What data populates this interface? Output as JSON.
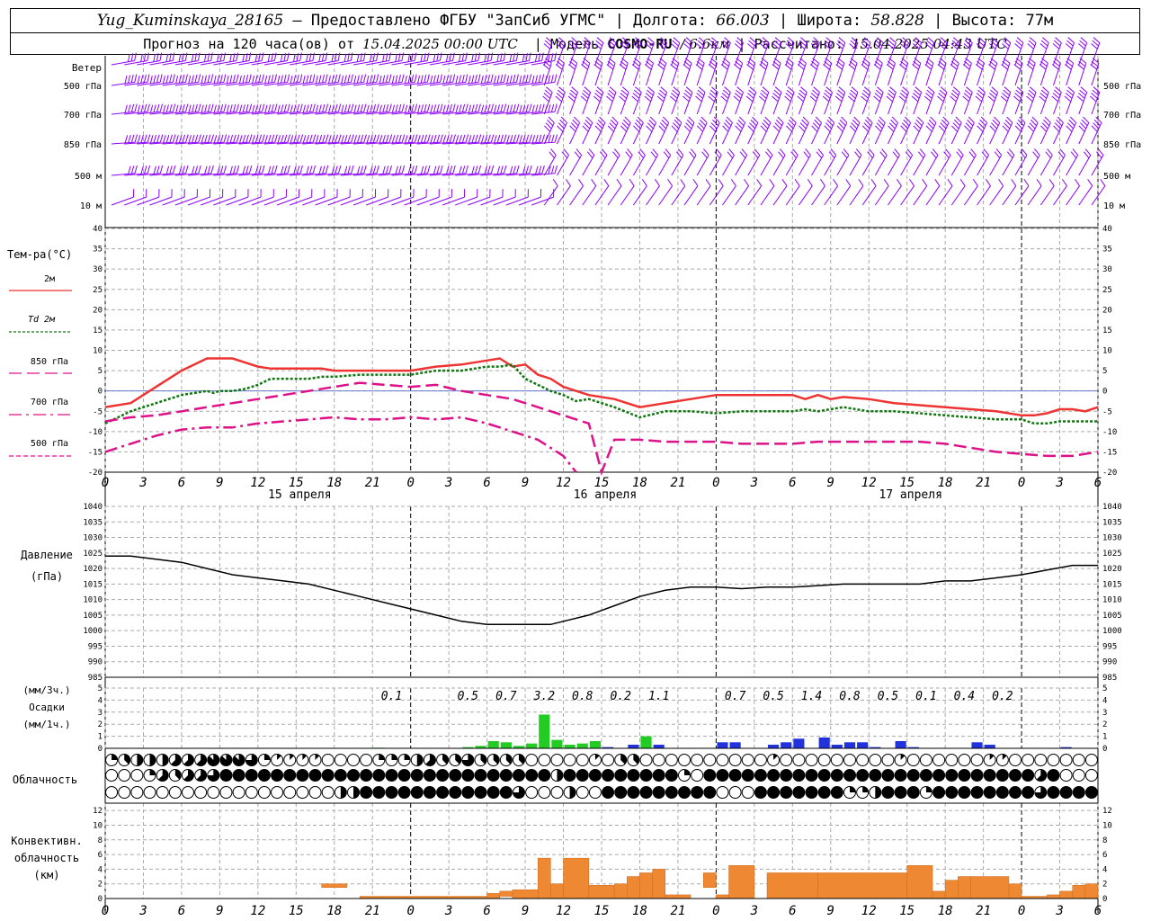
{
  "header": {
    "station": "Yug_Kuminskaya_28165",
    "provided": "— Предоставлено ФГБУ \"ЗапСиб УГМС\"",
    "lon_label": "Долгота:",
    "lon": "66.003",
    "lat_label": "Широта:",
    "lat": "58.828",
    "alt_label": "Высота:",
    "alt": "77м",
    "forecast_prefix": "Прогноз на 120 часа(ов) от",
    "forecast_time": "15.04.2025 00:00 UTC",
    "model_label": "Модель",
    "model": "COSMO-RU",
    "resolution": "/ 6.6км",
    "calc_label": "Рассчитано:",
    "calc_time": "15.04.2025 04:43 UTC"
  },
  "x_ticks": [
    "0",
    "3",
    "6",
    "9",
    "12",
    "15",
    "18",
    "21",
    "0",
    "3",
    "6",
    "9",
    "12",
    "15",
    "18",
    "21",
    "0",
    "3",
    "6",
    "9",
    "12",
    "15",
    "18",
    "21",
    "0",
    "3",
    "6"
  ],
  "day_labels": [
    {
      "text": "15 апреля",
      "hour": 15
    },
    {
      "text": "16 апреля",
      "hour": 39
    },
    {
      "text": "17 апреля",
      "hour": 63
    }
  ],
  "wind_panel": {
    "title": "Ветер",
    "levels": [
      "500 гПа",
      "700 гПа",
      "850 гПа",
      "500 м",
      "10 м"
    ],
    "color": "#8b00ff"
  },
  "chart_data": [
    {
      "type": "line",
      "title": "Тем-ра(°C)",
      "ylim": [
        -20,
        40
      ],
      "y_ticks": [
        -20,
        -15,
        -10,
        -5,
        0,
        5,
        10,
        15,
        20,
        25,
        30,
        35,
        40
      ],
      "series": [
        {
          "name": "2м",
          "color": "#ee3333",
          "style": "solid",
          "hours": [
            0,
            2,
            4,
            6,
            8,
            10,
            11,
            12,
            13,
            14,
            15,
            16,
            17,
            18,
            19,
            20,
            22,
            24,
            26,
            28,
            30,
            31,
            32,
            33,
            34,
            35,
            36,
            37,
            38,
            40,
            42,
            44,
            46,
            48,
            50,
            52,
            54,
            55,
            56,
            57,
            58,
            60,
            62,
            64,
            66,
            68,
            70,
            72,
            73,
            74,
            75,
            76,
            77,
            78
          ],
          "values": [
            -4,
            -3,
            1,
            5,
            8,
            8,
            7,
            6,
            5.5,
            5.5,
            5.5,
            5.5,
            5.5,
            5,
            5,
            5,
            5,
            5,
            6,
            6.5,
            7.5,
            8,
            6,
            6.5,
            4,
            3,
            1,
            0,
            -1,
            -2,
            -4,
            -3,
            -2,
            -1,
            -1,
            -1,
            -1,
            -2,
            -1,
            -2,
            -1.5,
            -2,
            -3,
            -3.5,
            -4,
            -4.5,
            -5,
            -6,
            -6,
            -5.5,
            -4.5,
            -4.5,
            -5,
            -4
          ]
        },
        {
          "name": "Td 2м",
          "color": "#117711",
          "style": "dotted",
          "hours": [
            0,
            2,
            4,
            6,
            8,
            8.5,
            9,
            10,
            11,
            12,
            13,
            14,
            15,
            16,
            17,
            18,
            20,
            22,
            24,
            26,
            28,
            30,
            31,
            32,
            33,
            34,
            35,
            36,
            37,
            38,
            40,
            42,
            44,
            46,
            48,
            50,
            52,
            54,
            55,
            56,
            57,
            58,
            60,
            62,
            64,
            66,
            68,
            70,
            72,
            73,
            74,
            75,
            76,
            77,
            78
          ],
          "values": [
            -8,
            -5,
            -3,
            -1,
            0,
            -0.5,
            0,
            0,
            0.5,
            1.5,
            3,
            3,
            3,
            3,
            3.5,
            3.5,
            4,
            4,
            4,
            5,
            5,
            6,
            6,
            6.5,
            3,
            1.5,
            0,
            -1,
            -2.5,
            -2,
            -4,
            -6.5,
            -5,
            -5,
            -5.5,
            -5,
            -5,
            -5,
            -4.5,
            -5,
            -4.5,
            -4,
            -5,
            -5,
            -5.5,
            -6,
            -6.5,
            -7,
            -7,
            -8,
            -8,
            -7.5,
            -7.5,
            -7.5,
            -7.5
          ]
        },
        {
          "name": "850 гПа",
          "color": "#dd1188",
          "style": "longdash",
          "hours": [
            0,
            2,
            4,
            6,
            8,
            10,
            12,
            14,
            16,
            18,
            20,
            22,
            24,
            26,
            28,
            30,
            32,
            34,
            36,
            38,
            39,
            40,
            42,
            44,
            46,
            48,
            50,
            52,
            54,
            56,
            58,
            60,
            62,
            64,
            66,
            68,
            70,
            72,
            74,
            76,
            78
          ],
          "values": [
            -7.5,
            -6.5,
            -6,
            -5,
            -4,
            -3,
            -2,
            -1,
            0,
            1,
            2,
            1.5,
            1,
            1.5,
            0,
            -1,
            -2,
            -4,
            -6,
            -8,
            -20,
            -12,
            -12,
            -12.5,
            -12.5,
            -12.5,
            -13,
            -13,
            -13,
            -12.5,
            -12.5,
            -12.5,
            -12.5,
            -12.5,
            -13,
            -14,
            -15,
            -15.5,
            -16,
            -16,
            -15
          ]
        },
        {
          "name": "700 гПа",
          "color": "#dd1188",
          "style": "dashdot",
          "hours": [
            0,
            2,
            4,
            6,
            8,
            10,
            12,
            14,
            16,
            18,
            20,
            22,
            24,
            26,
            28,
            30,
            32,
            34,
            36,
            37
          ],
          "values": [
            -15,
            -13,
            -11,
            -9.5,
            -9,
            -9,
            -8,
            -7.5,
            -7,
            -6.5,
            -7,
            -7,
            -6.5,
            -7,
            -6.5,
            -8,
            -10,
            -12,
            -16,
            -20
          ]
        }
      ],
      "legend": [
        {
          "label": "2м",
          "color": "#ee3333",
          "style": "solid"
        },
        {
          "label": "Td 2м",
          "color": "#117711",
          "style": "dotted"
        },
        {
          "label": "850 гПа",
          "color": "#dd1188",
          "style": "longdash"
        },
        {
          "label": "700 гПа",
          "color": "#dd1188",
          "style": "dashdot"
        },
        {
          "label": "500 гПа",
          "color": "#dd1188",
          "style": "short"
        }
      ]
    },
    {
      "type": "line",
      "title": "Давление (гПа)",
      "ylim": [
        985,
        1040
      ],
      "y_ticks": [
        985,
        990,
        995,
        1000,
        1005,
        1010,
        1015,
        1020,
        1025,
        1030,
        1035,
        1040
      ],
      "series": [
        {
          "name": "Давление",
          "color": "#000000",
          "style": "solid",
          "hours": [
            0,
            2,
            4,
            6,
            8,
            10,
            12,
            14,
            16,
            18,
            20,
            22,
            24,
            26,
            28,
            30,
            32,
            34,
            35,
            36,
            38,
            40,
            42,
            44,
            46,
            48,
            50,
            52,
            54,
            56,
            58,
            60,
            62,
            64,
            66,
            68,
            70,
            72,
            74,
            76,
            78
          ],
          "values": [
            1024,
            1024,
            1023,
            1022,
            1020,
            1018,
            1017,
            1016,
            1015,
            1013,
            1011,
            1009,
            1007,
            1005,
            1003,
            1002,
            1002,
            1002,
            1002,
            1003,
            1005,
            1008,
            1011,
            1013,
            1014,
            1014,
            1013.5,
            1014,
            1014,
            1014.5,
            1015,
            1015,
            1015,
            1015,
            1016,
            1016,
            1017,
            1018,
            1019.5,
            1021,
            1021
          ]
        }
      ]
    },
    {
      "type": "bar",
      "title": "Осадки",
      "units_3h": "(мм/3ч.)",
      "units_1h": "(мм/1ч.)",
      "ylim": [
        0,
        5
      ],
      "y_ticks": [
        0,
        1,
        2,
        3,
        4,
        5
      ],
      "totals_3h": [
        {
          "hour": 22.5,
          "value": "0.1"
        },
        {
          "hour": 28.5,
          "value": "0.5"
        },
        {
          "hour": 31.5,
          "value": "0.7"
        },
        {
          "hour": 34.5,
          "value": "3.2"
        },
        {
          "hour": 37.5,
          "value": "0.8"
        },
        {
          "hour": 40.5,
          "value": "0.2"
        },
        {
          "hour": 43.5,
          "value": "1.1"
        },
        {
          "hour": 49.5,
          "value": "0.7"
        },
        {
          "hour": 52.5,
          "value": "0.5"
        },
        {
          "hour": 55.5,
          "value": "1.4"
        },
        {
          "hour": 58.5,
          "value": "0.8"
        },
        {
          "hour": 61.5,
          "value": "0.5"
        },
        {
          "hour": 64.5,
          "value": "0.1"
        },
        {
          "hour": 67.5,
          "value": "0.4"
        },
        {
          "hour": 70.5,
          "value": "0.2"
        }
      ],
      "hourly": [
        {
          "hour": 21,
          "value": 0.05,
          "kind": "rain"
        },
        {
          "hour": 28,
          "value": 0.1,
          "kind": "rain"
        },
        {
          "hour": 29,
          "value": 0.2,
          "kind": "rain"
        },
        {
          "hour": 30,
          "value": 0.6,
          "kind": "rain"
        },
        {
          "hour": 31,
          "value": 0.5,
          "kind": "rain"
        },
        {
          "hour": 32,
          "value": 0.2,
          "kind": "rain"
        },
        {
          "hour": 33,
          "value": 0.4,
          "kind": "rain"
        },
        {
          "hour": 34,
          "value": 2.8,
          "kind": "rain"
        },
        {
          "hour": 35,
          "value": 0.7,
          "kind": "rain"
        },
        {
          "hour": 36,
          "value": 0.3,
          "kind": "rain"
        },
        {
          "hour": 37,
          "value": 0.4,
          "kind": "rain"
        },
        {
          "hour": 38,
          "value": 0.6,
          "kind": "rain"
        },
        {
          "hour": 39,
          "value": 0.1,
          "kind": "snow"
        },
        {
          "hour": 41,
          "value": 0.3,
          "kind": "snow"
        },
        {
          "hour": 42,
          "value": 1.0,
          "kind": "rain"
        },
        {
          "hour": 43,
          "value": 0.3,
          "kind": "snow"
        },
        {
          "hour": 48,
          "value": 0.5,
          "kind": "snow"
        },
        {
          "hour": 49,
          "value": 0.5,
          "kind": "snow"
        },
        {
          "hour": 52,
          "value": 0.3,
          "kind": "snow"
        },
        {
          "hour": 53,
          "value": 0.5,
          "kind": "snow"
        },
        {
          "hour": 54,
          "value": 0.8,
          "kind": "snow"
        },
        {
          "hour": 56,
          "value": 0.9,
          "kind": "snow"
        },
        {
          "hour": 57,
          "value": 0.3,
          "kind": "snow"
        },
        {
          "hour": 58,
          "value": 0.5,
          "kind": "snow"
        },
        {
          "hour": 59,
          "value": 0.5,
          "kind": "snow"
        },
        {
          "hour": 60,
          "value": 0.1,
          "kind": "snow"
        },
        {
          "hour": 62,
          "value": 0.6,
          "kind": "snow"
        },
        {
          "hour": 63,
          "value": 0.1,
          "kind": "snow"
        },
        {
          "hour": 68,
          "value": 0.5,
          "kind": "snow"
        },
        {
          "hour": 69,
          "value": 0.3,
          "kind": "snow"
        },
        {
          "hour": 75,
          "value": 0.1,
          "kind": "snow"
        }
      ],
      "colors": {
        "rain": "#22cc22",
        "snow": "#2233dd"
      }
    },
    {
      "type": "bar",
      "title": "Конвективн. облачность (км)",
      "ylim": [
        0,
        13
      ],
      "y_ticks": [
        0,
        2,
        4,
        6,
        8,
        10,
        12
      ],
      "color": "#ee8833",
      "bars": [
        {
          "h0": 17,
          "h1": 19,
          "bottom": 1.5,
          "top": 2
        },
        {
          "h0": 20,
          "h1": 30,
          "bottom": 0,
          "top": 0.3
        },
        {
          "h0": 30,
          "h1": 31,
          "bottom": 0,
          "top": 0.7
        },
        {
          "h0": 31,
          "h1": 32,
          "bottom": 0.3,
          "top": 1
        },
        {
          "h0": 32,
          "h1": 34,
          "bottom": 0,
          "top": 1.2
        },
        {
          "h0": 34,
          "h1": 35,
          "bottom": 0,
          "top": 5.5
        },
        {
          "h0": 35,
          "h1": 36,
          "bottom": 0,
          "top": 2
        },
        {
          "h0": 36,
          "h1": 38,
          "bottom": 0,
          "top": 5.5
        },
        {
          "h0": 38,
          "h1": 40,
          "bottom": 0,
          "top": 1.8
        },
        {
          "h0": 40,
          "h1": 41,
          "bottom": 0,
          "top": 2
        },
        {
          "h0": 41,
          "h1": 42,
          "bottom": 0,
          "top": 3
        },
        {
          "h0": 42,
          "h1": 43,
          "bottom": 0,
          "top": 3.5
        },
        {
          "h0": 43,
          "h1": 44,
          "bottom": 0,
          "top": 4
        },
        {
          "h0": 44,
          "h1": 46,
          "bottom": 0,
          "top": 0.5
        },
        {
          "h0": 47,
          "h1": 48,
          "bottom": 1.5,
          "top": 3.5
        },
        {
          "h0": 48,
          "h1": 49,
          "bottom": 0,
          "top": 0.5
        },
        {
          "h0": 49,
          "h1": 51,
          "bottom": 0,
          "top": 4.5
        },
        {
          "h0": 52,
          "h1": 56,
          "bottom": 0,
          "top": 3.5
        },
        {
          "h0": 56,
          "h1": 63,
          "bottom": 0,
          "top": 3.5
        },
        {
          "h0": 63,
          "h1": 65,
          "bottom": 0,
          "top": 4.5
        },
        {
          "h0": 65,
          "h1": 66,
          "bottom": 0,
          "top": 1
        },
        {
          "h0": 66,
          "h1": 67,
          "bottom": 0,
          "top": 2.5
        },
        {
          "h0": 67,
          "h1": 68,
          "bottom": 0,
          "top": 3
        },
        {
          "h0": 68,
          "h1": 71,
          "bottom": 0,
          "top": 3
        },
        {
          "h0": 71,
          "h1": 72,
          "bottom": 0,
          "top": 2
        },
        {
          "h0": 72,
          "h1": 74,
          "bottom": 0,
          "top": 0.3
        },
        {
          "h0": 74,
          "h1": 75,
          "bottom": 0,
          "top": 0.5
        },
        {
          "h0": 75,
          "h1": 76,
          "bottom": 0,
          "top": 1
        },
        {
          "h0": 76,
          "h1": 77,
          "bottom": 0,
          "top": 1.8
        },
        {
          "h0": 77,
          "h1": 78,
          "bottom": 0,
          "top": 2
        }
      ]
    }
  ],
  "cloud_panel": {
    "title": "Облачность",
    "rows": [
      "234445557776211110000222453363333000001033000000000010000000001000000110000000",
      "000253556888888888888888888888888884888888888208888888888888888888888888858000",
      "000000000000000000448888888888886000400888888888000888888822488828888888868888"
    ]
  }
}
